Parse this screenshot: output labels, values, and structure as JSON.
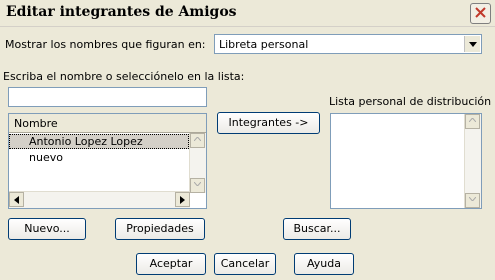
{
  "window": {
    "title": "Editar integrantes de Amigos"
  },
  "show_names": {
    "label": "Mostrar los nombres que figuran en:",
    "selected": "Libreta personal"
  },
  "search": {
    "label": "Escriba el nombre o selecciónelo en la lista:",
    "value": ""
  },
  "name_list": {
    "header": "Nombre",
    "items": [
      {
        "name": "Antonio Lopez Lopez",
        "selected": true
      },
      {
        "name": "nuevo",
        "selected": false
      }
    ]
  },
  "members_button": "Integrantes ->",
  "distribution": {
    "label": "Lista personal de distribución",
    "items": []
  },
  "buttons": {
    "new": "Nuevo...",
    "properties": "Propiedades",
    "find": "Buscar...",
    "accept": "Aceptar",
    "cancel": "Cancelar",
    "help": "Ayuda"
  },
  "colors": {
    "window_bg": "#ece9d8",
    "field_border": "#7f9db9",
    "button_border": "#003c74",
    "close_x": "#c1392b"
  },
  "icons": [
    "close-icon",
    "chevron-down-icon",
    "scroll-up-icon",
    "scroll-down-icon",
    "scroll-left-icon",
    "scroll-right-icon"
  ]
}
